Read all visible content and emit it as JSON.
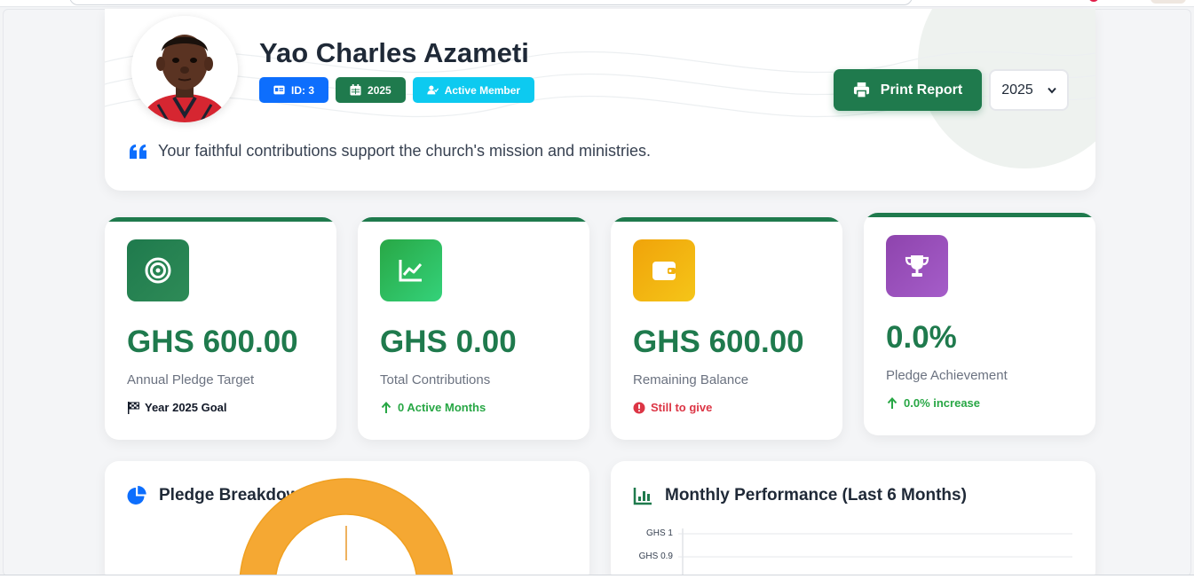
{
  "profile": {
    "name": "Yao Charles Azameti",
    "badges": [
      {
        "label": "ID: 3",
        "icon": "id-card-icon",
        "color": "#0d6efd"
      },
      {
        "label": "2025",
        "icon": "calendar-icon",
        "color": "#1f7a4d"
      },
      {
        "label": "Active Member",
        "icon": "user-check-icon",
        "color": "#0dcaf0"
      }
    ],
    "quote": "Your faithful contributions support the church's mission and ministries."
  },
  "actions": {
    "print_label": "Print Report",
    "year_selected": "2025"
  },
  "stats": [
    {
      "icon": "target-icon",
      "value": "GHS 600.00",
      "label": "Annual Pledge Target",
      "foot": "Year 2025 Goal",
      "foot_icon": "flag-checkered-icon",
      "foot_color": "#111827"
    },
    {
      "icon": "chart-line-icon",
      "value": "GHS 0.00",
      "label": "Total Contributions",
      "foot": "0 Active Months",
      "foot_icon": "arrow-up-icon",
      "foot_color": "#28a745"
    },
    {
      "icon": "wallet-icon",
      "value": "GHS 600.00",
      "label": "Remaining Balance",
      "foot": "Still to give",
      "foot_icon": "exclamation-circle-icon",
      "foot_color": "#dc3545"
    },
    {
      "icon": "trophy-icon",
      "value": "0.0%",
      "label": "Pledge Achievement",
      "foot": "0.0% increase",
      "foot_icon": "arrow-up-icon",
      "foot_color": "#28a745"
    }
  ],
  "panels": {
    "pledge_breakdown_title": "Pledge Breakdown",
    "monthly_title": "Monthly Performance (Last 6 Months)",
    "monthly_ticks": [
      "GHS 1",
      "GHS 0.9"
    ]
  },
  "chart_data": [
    {
      "type": "pie",
      "title": "",
      "labels": [],
      "values": [
        600
      ],
      "colors": [
        "#f5a833"
      ]
    },
    {
      "type": "line",
      "title": "",
      "ylim": [
        0,
        1
      ],
      "yticks": [
        "GHS 1",
        "GHS 0.9"
      ],
      "series": []
    }
  ],
  "colors": {
    "brand_green": "#1f7a4d",
    "blue": "#0d6efd",
    "cyan": "#0dcaf0",
    "success": "#28a745",
    "danger": "#dc3545",
    "amber": "#f5a833",
    "purple": "#8e44ad"
  }
}
